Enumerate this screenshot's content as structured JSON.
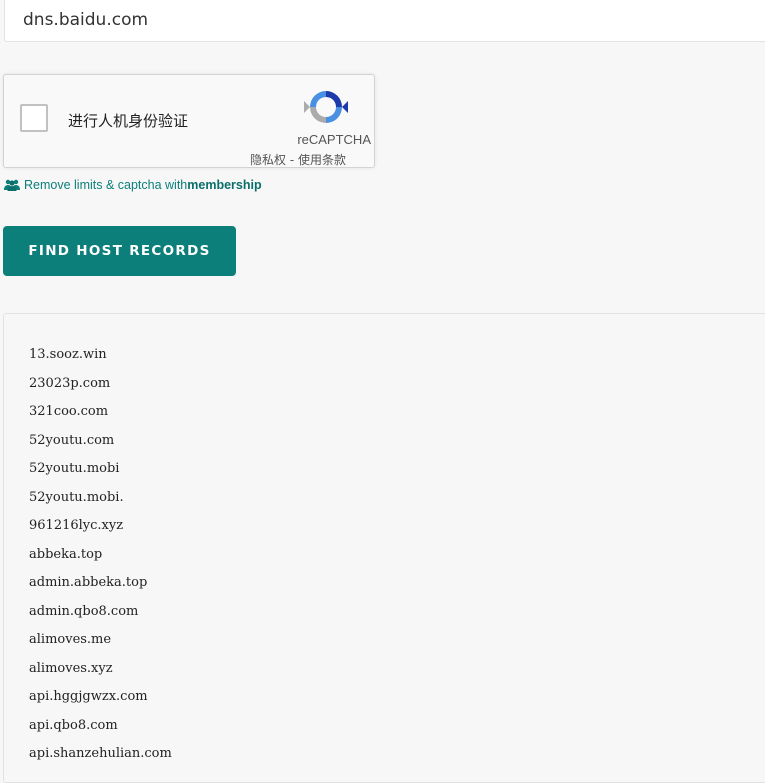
{
  "search": {
    "value": "dns.baidu.com"
  },
  "recaptcha": {
    "label": "进行人机身份验证",
    "brand": "reCAPTCHA",
    "terms": "隐私权 - 使用条款"
  },
  "membership": {
    "text": "Remove limits & captcha with ",
    "bold_text": "membership",
    "icon": "users-icon",
    "color": "#0b7e79"
  },
  "find_button": {
    "label": "FIND HOST RECORDS",
    "color": "#0c7f7b"
  },
  "results": [
    "13.sooz.win",
    "23023p.com",
    "321coo.com",
    "52youtu.com",
    "52youtu.mobi",
    "52youtu.mobi.",
    "961216lyc.xyz",
    "abbeka.top",
    "admin.abbeka.top",
    "admin.qbo8.com",
    "alimoves.me",
    "alimoves.xyz",
    "api.hggjgwzx.com",
    "api.qbo8.com",
    "api.shanzehulian.com"
  ]
}
